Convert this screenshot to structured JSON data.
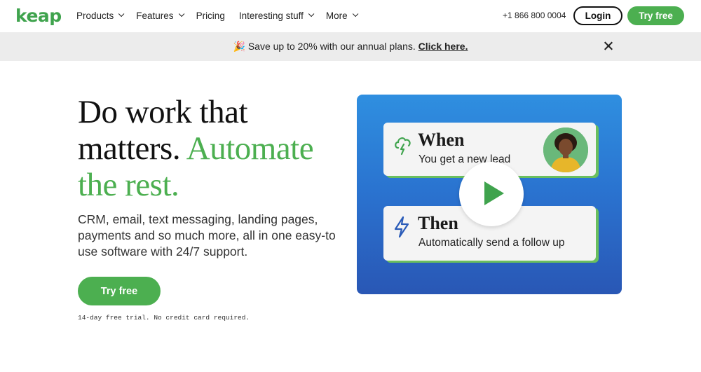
{
  "nav": {
    "logo": "keap",
    "links": [
      {
        "label": "Products",
        "dropdown": true
      },
      {
        "label": "Features",
        "dropdown": true
      },
      {
        "label": "Pricing",
        "dropdown": false
      },
      {
        "label": "Interesting stuff",
        "dropdown": true
      },
      {
        "label": "More",
        "dropdown": true
      }
    ],
    "phone": "+1 866 800 0004",
    "login_label": "Login",
    "try_free_label": "Try free"
  },
  "banner": {
    "emoji": "🎉",
    "text": "Save up to 20% with our annual plans.",
    "link_label": "Click here.",
    "close_icon": "close-icon"
  },
  "hero": {
    "title_part1": "Do work that matters.",
    "title_part2": "Automate the rest.",
    "subtitle": "CRM, email, text messaging, landing pages, payments and so much more, all in one easy-to use software with 24/7 support.",
    "cta_label": "Try free",
    "trial_note": "14-day free trial. No credit card required."
  },
  "video": {
    "when_title": "When",
    "when_desc": "You get a new lead",
    "then_title": "Then",
    "then_desc": "Automatically send a follow up",
    "when_icon": "cloud-lightning-icon",
    "then_icon": "lightning-icon",
    "play_icon": "play-icon"
  },
  "colors": {
    "brand_green": "#4caf50",
    "banner_bg": "#ececec",
    "video_blue": "#2a72cf"
  }
}
